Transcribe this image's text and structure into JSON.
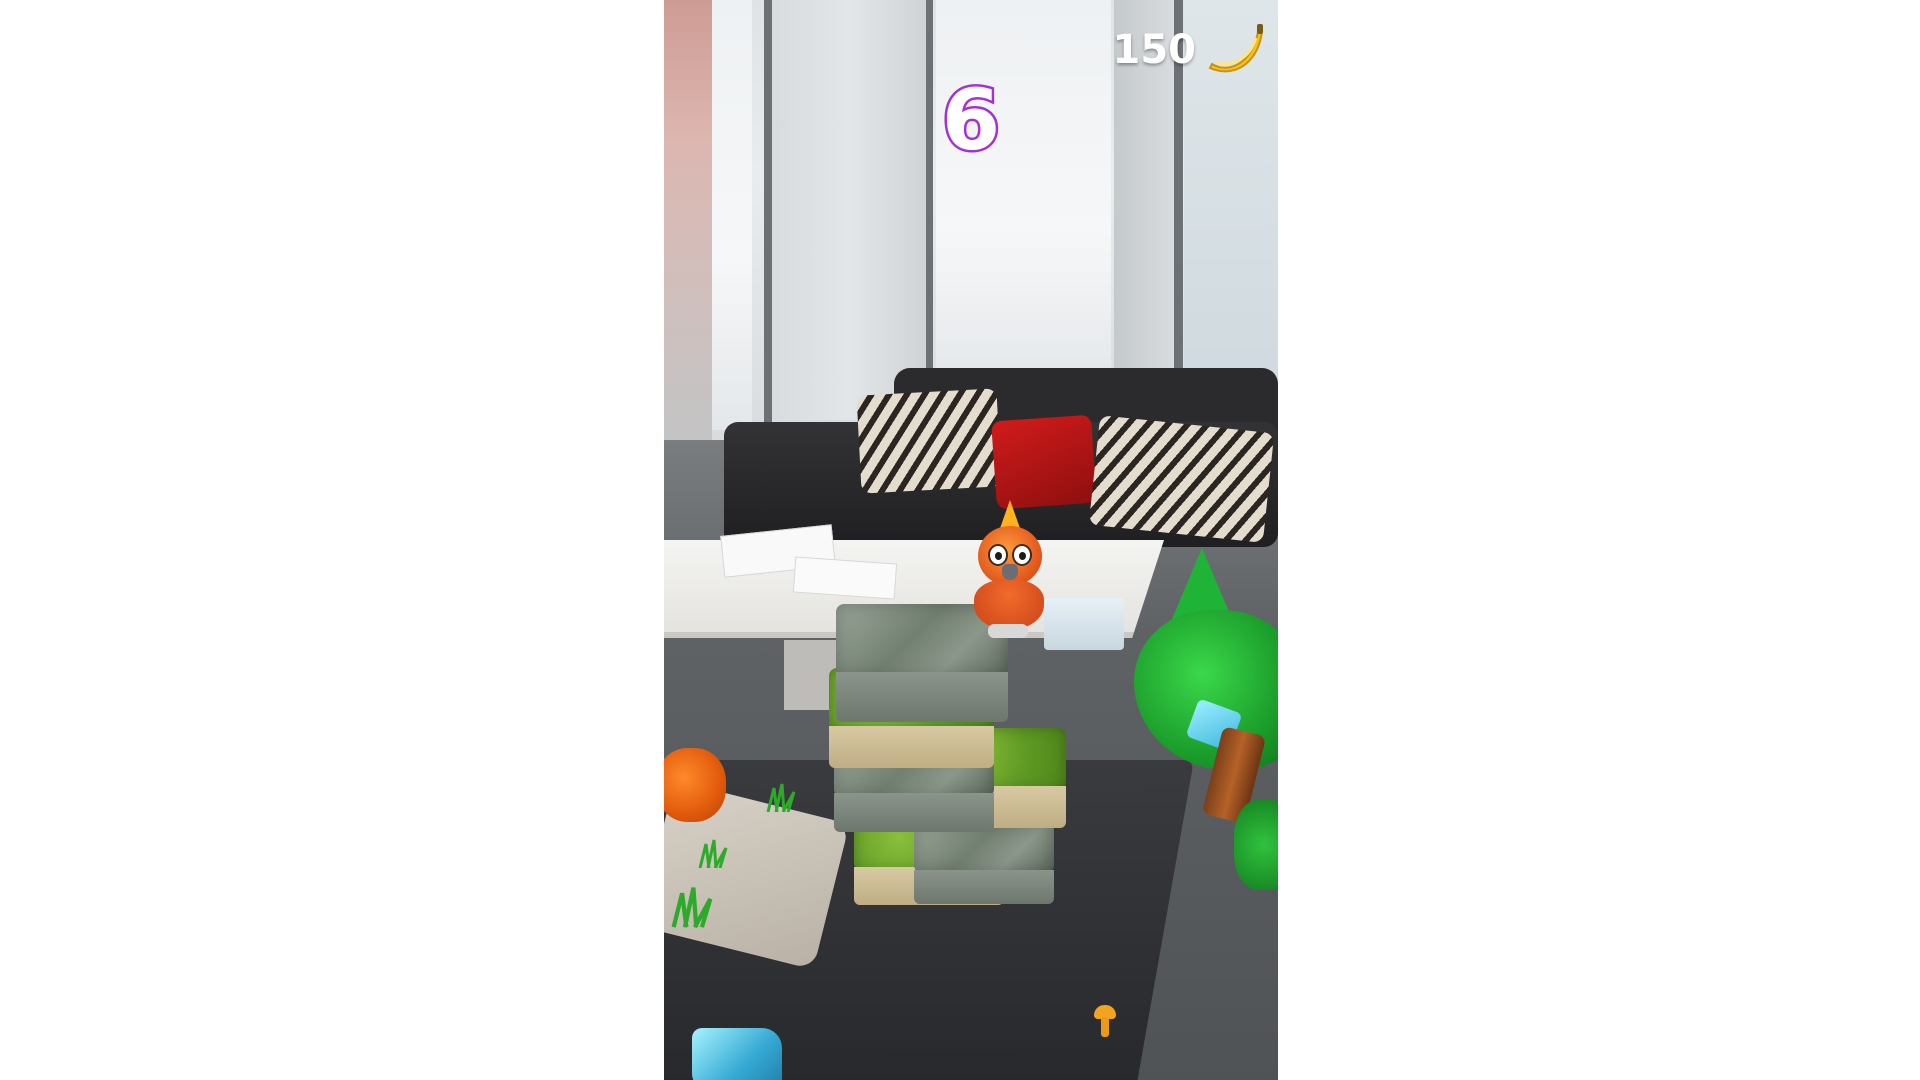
{
  "hud": {
    "score": "6",
    "banana_count": "150",
    "banana_icon": "banana-icon"
  },
  "colors": {
    "score_outline": "#a52fd1",
    "hud_text": "#ffffff",
    "banana": "#f7c21b"
  },
  "scene": {
    "character": "parrot",
    "props": [
      "block-tower",
      "tree",
      "crystal",
      "orange-bush",
      "grass-tuft",
      "mushroom"
    ]
  }
}
